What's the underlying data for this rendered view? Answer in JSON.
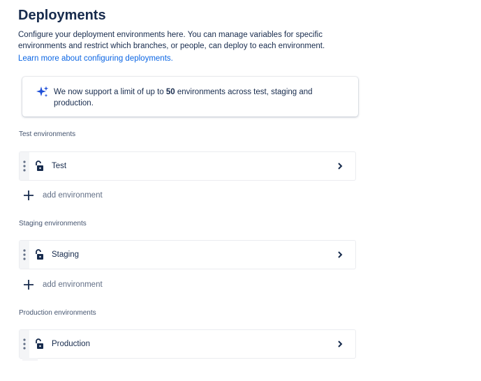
{
  "header": {
    "title": "Deployments",
    "description": "Configure your deployment environments here. You can manage variables for specific environments and restrict which branches, or people, can deploy to each environment.",
    "learn_more_link": "Learn more about configuring deployments."
  },
  "banner": {
    "icon": "sparkle-icon",
    "text_before": "We now support a limit of up to ",
    "text_bold": "50",
    "text_after": " environments across test, staging and production."
  },
  "sections": [
    {
      "heading": "Test environments",
      "environments": [
        {
          "name": "Test",
          "lock_icon": "unlock-icon"
        }
      ],
      "add_label": "add environment"
    },
    {
      "heading": "Staging environments",
      "environments": [
        {
          "name": "Staging",
          "lock_icon": "unlock-icon"
        }
      ],
      "add_label": "add environment"
    },
    {
      "heading": "Production environments",
      "environments": [
        {
          "name": "Production",
          "lock_icon": "unlock-icon"
        }
      ]
    }
  ],
  "colors": {
    "text": "#172b4d",
    "link": "#0c66e4",
    "subtle_text": "#44546f",
    "sparkle": "#1d4ed8"
  }
}
